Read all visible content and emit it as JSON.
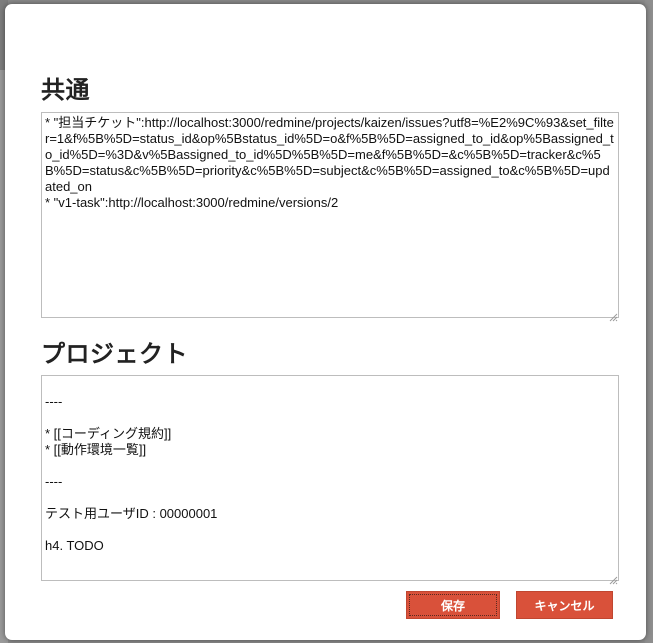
{
  "colors": {
    "button_bg": "#d9513a",
    "button_text": "#ffffff",
    "title_text": "#222222",
    "textarea_border": "#bdbdbd"
  },
  "common": {
    "title": "共通",
    "text": "* \"担当チケット\":http://localhost:3000/redmine/projects/kaizen/issues?utf8=%E2%9C%93&set_filter=1&f%5B%5D=status_id&op%5Bstatus_id%5D=o&f%5B%5D=assigned_to_id&op%5Bassigned_to_id%5D=%3D&v%5Bassigned_to_id%5D%5B%5D=me&f%5B%5D=&c%5B%5D=tracker&c%5B%5D=status&c%5B%5D=priority&c%5B%5D=subject&c%5B%5D=assigned_to&c%5B%5D=updated_on\n* \"v1-task\":http://localhost:3000/redmine/versions/2"
  },
  "project": {
    "title": "プロジェクト",
    "text": "\n----\n\n* [[コーディング規約]]\n* [[動作環境一覧]]\n\n----\n\nテスト用ユーザID : 00000001\n\nh4. TODO"
  },
  "buttons": {
    "save": "保存",
    "cancel": "キャンセル"
  },
  "icons": {
    "resize_grip": "resize-grip-icon"
  }
}
